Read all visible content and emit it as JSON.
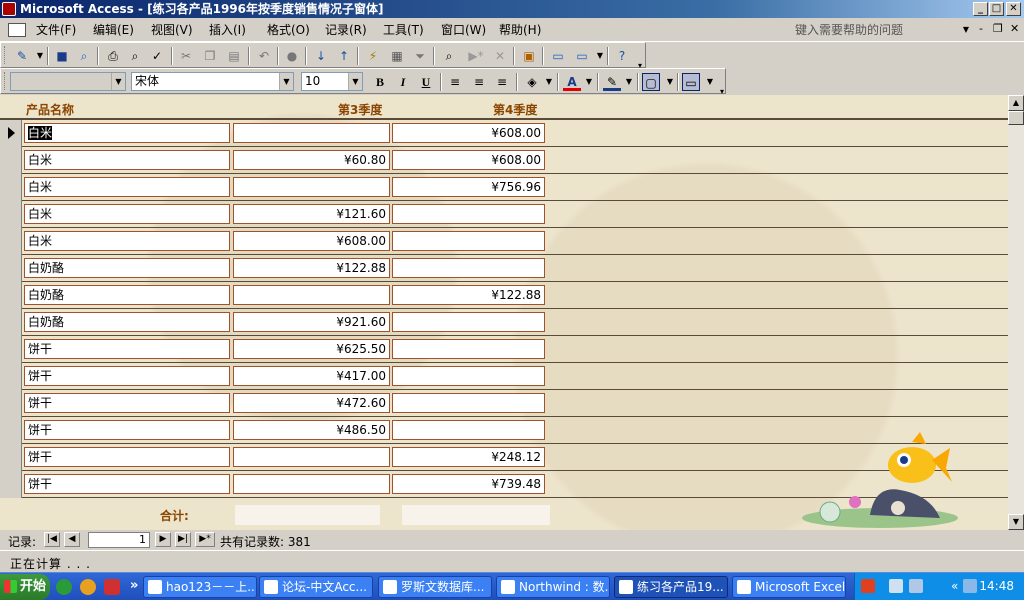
{
  "window": {
    "title": "Microsoft Access - [练习各产品1996年按季度销售情况子窗体]",
    "min": "_",
    "max": "□",
    "close": "✕"
  },
  "menu": {
    "items": [
      "文件(F)",
      "编辑(E)",
      "视图(V)",
      "插入(I)",
      "格式(O)",
      "记录(R)",
      "工具(T)",
      "窗口(W)",
      "帮助(H)"
    ],
    "help_placeholder": "键入需要帮助的问题",
    "mdi_min": "-",
    "mdi_restore": "❐",
    "mdi_close": "✕"
  },
  "format_bar": {
    "object_combo": "",
    "font": "宋体",
    "size": "10",
    "bold": "B",
    "italic": "I",
    "underline": "U"
  },
  "form": {
    "headers": {
      "product": "产品名称",
      "q3": "第3季度",
      "q4": "第4季度"
    },
    "rows": [
      {
        "product": "白米",
        "q3": "",
        "q4": "¥608.00",
        "current": true
      },
      {
        "product": "白米",
        "q3": "¥60.80",
        "q4": "¥608.00"
      },
      {
        "product": "白米",
        "q3": "",
        "q4": "¥756.96"
      },
      {
        "product": "白米",
        "q3": "¥121.60",
        "q4": ""
      },
      {
        "product": "白米",
        "q3": "¥608.00",
        "q4": ""
      },
      {
        "product": "白奶酪",
        "q3": "¥122.88",
        "q4": ""
      },
      {
        "product": "白奶酪",
        "q3": "",
        "q4": "¥122.88"
      },
      {
        "product": "白奶酪",
        "q3": "¥921.60",
        "q4": ""
      },
      {
        "product": "饼干",
        "q3": "¥625.50",
        "q4": ""
      },
      {
        "product": "饼干",
        "q3": "¥417.00",
        "q4": ""
      },
      {
        "product": "饼干",
        "q3": "¥472.60",
        "q4": ""
      },
      {
        "product": "饼干",
        "q3": "¥486.50",
        "q4": ""
      },
      {
        "product": "饼干",
        "q3": "",
        "q4": "¥248.12"
      },
      {
        "product": "饼干",
        "q3": "",
        "q4": "¥739.48"
      }
    ],
    "footer_label": "合计:"
  },
  "navigation": {
    "label": "记录:",
    "current": "1",
    "total": "共有记录数: 381",
    "first": "|◀",
    "prev": "◀",
    "next": "▶",
    "last": "▶|",
    "new": "▶*"
  },
  "status": {
    "text": "正在计算 . . ."
  },
  "taskbar": {
    "start": "开始",
    "more": "»",
    "tasks": [
      {
        "label": "hao123－－上...",
        "active": false
      },
      {
        "label": "论坛-中文Acc...",
        "active": false
      },
      {
        "label": "罗斯文数据库...",
        "active": false
      },
      {
        "label": "Northwind : 数...",
        "active": false
      },
      {
        "label": "练习各产品19...",
        "active": true
      },
      {
        "label": "Microsoft Excel ...",
        "active": false
      }
    ],
    "tray_more": "«",
    "clock": "14:48"
  },
  "colors": {
    "form_bg": "#ede4cc",
    "header_text": "#8b4500",
    "field_border": "#a0522d",
    "title_bar": "#0a246a"
  }
}
